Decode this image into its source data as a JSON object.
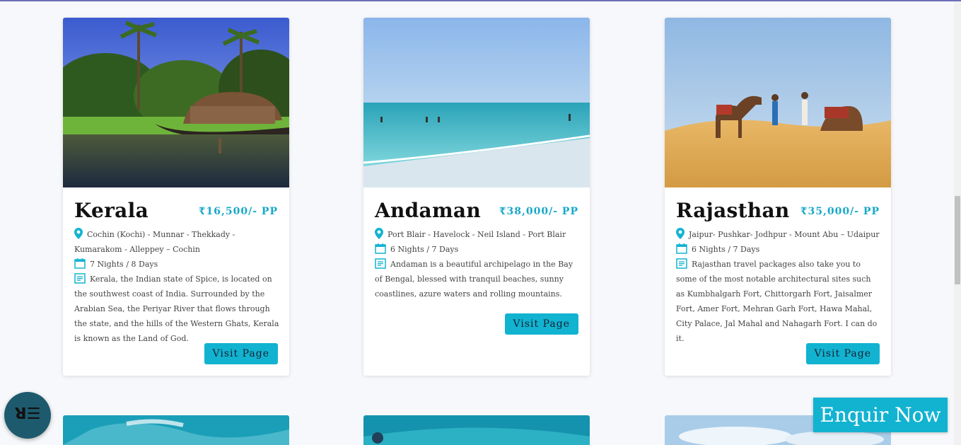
{
  "cards": [
    {
      "title": "Kerala",
      "price": "₹16,500/- PP",
      "route": "Cochin (Kochi) - Munnar - Thekkady - Kumarakom - Alleppey – Cochin",
      "duration": "7 Nights / 8 Days",
      "description": "Kerala, the Indian state of Spice, is located on the southwest coast of India. Surrounded by the Arabian Sea, the Periyar River that flows through the state, and the hills of the Western Ghats, Kerala is known as the Land of God.",
      "button": "Visit Page"
    },
    {
      "title": "Andaman",
      "price": "₹38,000/- PP",
      "route": "Port Blair - Havelock - Neil Island - Port Blair",
      "duration": "6 Nights / 7 Days",
      "description": "Andaman is a beautiful archipelago in the Bay of Bengal, blessed with tranquil beaches, sunny coastlines, azure waters and rolling mountains.",
      "button": "Visit Page"
    },
    {
      "title": "Rajasthan",
      "price": "₹35,000/- PP",
      "route": "Jaipur- Pushkar- Jodhpur - Mount Abu – Udaipur",
      "duration": "6 Nights / 7 Days",
      "description": "Rajasthan travel packages also take you to some of the most notable architectural sites such as Kumbhalgarh Fort, Chittorgarh Fort, Jaisalmer Fort, Amer Fort, Mehran Garh Fort, Hawa Mahal, City Palace, Jal Mahal and Nahagarh Fort. I can do it.",
      "button": "Visit Page"
    }
  ],
  "icons": {
    "location": "location-pin-icon",
    "calendar": "calendar-icon",
    "description": "document-lines-icon",
    "menu": "menu-icon"
  },
  "colors": {
    "accent": "#12b3d1",
    "price": "#17a8c9",
    "fab": "#1e5a6e"
  },
  "fab_label": "ꓤ☰",
  "enquire": "Enquir Now"
}
